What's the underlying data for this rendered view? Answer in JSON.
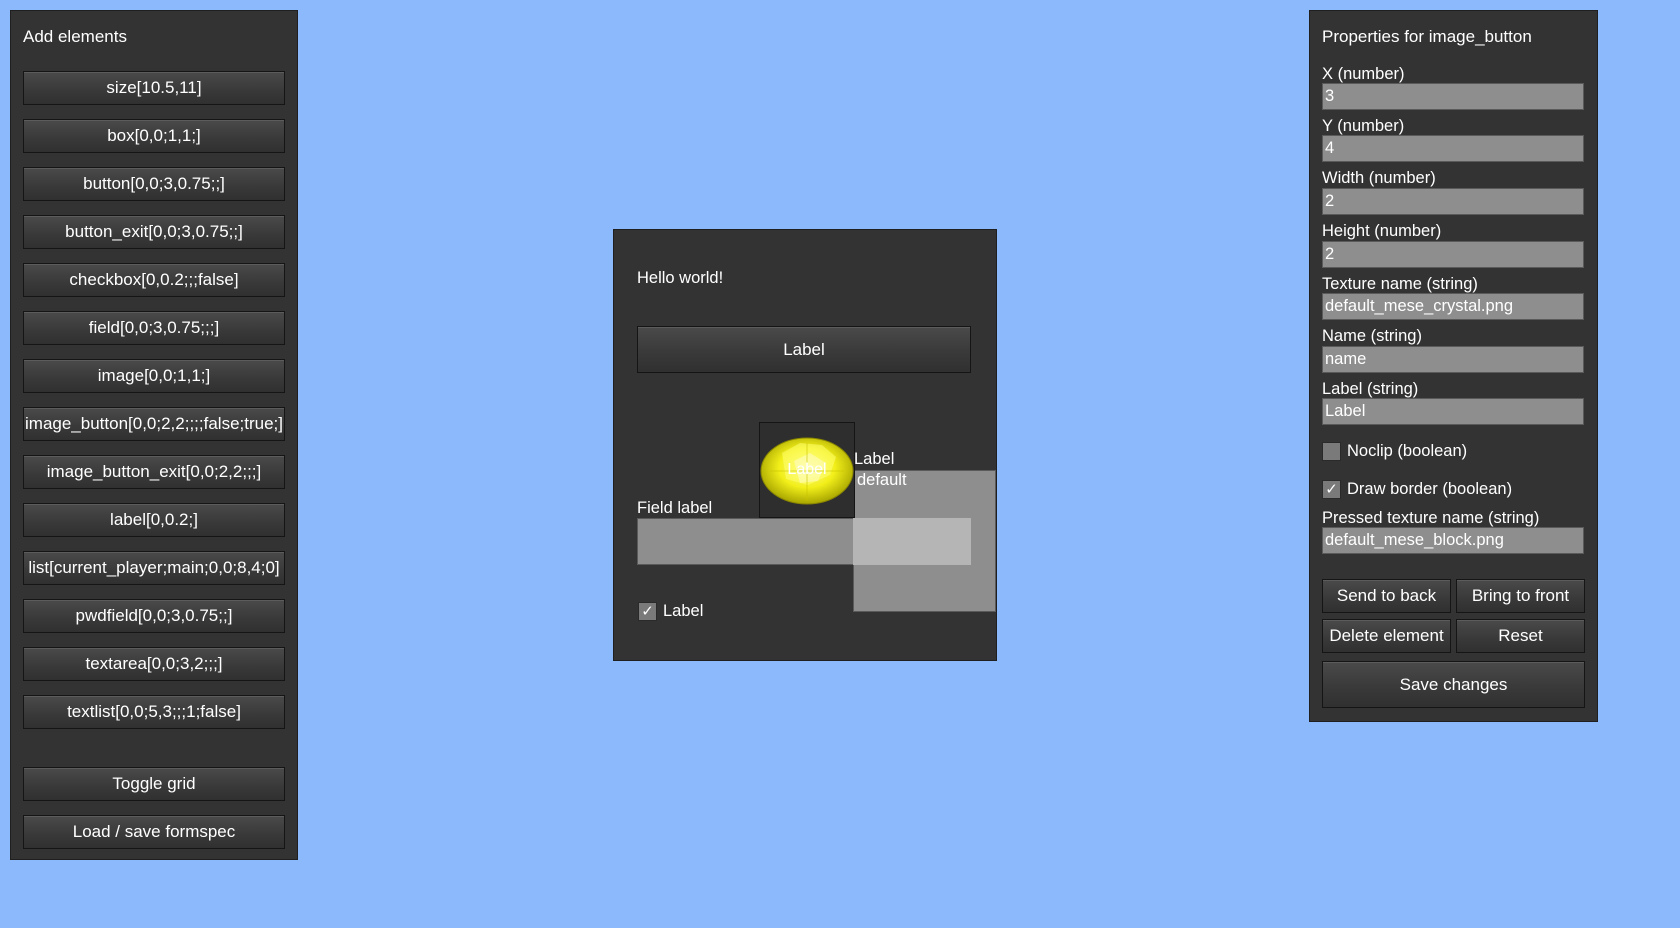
{
  "left_panel": {
    "title": "Add elements",
    "elements": [
      "size[10.5,11]",
      "box[0,0;1,1;]",
      "button[0,0;3,0.75;;]",
      "button_exit[0,0;3,0.75;;]",
      "checkbox[0,0.2;;;false]",
      "field[0,0;3,0.75;;;]",
      "image[0,0;1,1;]",
      "image_button[0,0;2,2;;;;false;true;]",
      "image_button_exit[0,0;2,2;;;]",
      "label[0,0.2;]",
      "list[current_player;main;0,0;8,4;0]",
      "pwdfield[0,0;3,0.75;;]",
      "textarea[0,0;3,2;;;]",
      "textlist[0,0;5,3;;;1;false]"
    ],
    "toggle_grid": "Toggle grid",
    "load_save": "Load / save formspec"
  },
  "preview": {
    "hello": "Hello world!",
    "button_label": "Label",
    "image_button_label": "Label",
    "image_name": "mese-crystal",
    "textlist_label": "Label",
    "textlist_item": "default",
    "field_label": "Field label",
    "field_value": "",
    "checkbox_label": "Label",
    "checkbox_checked": true
  },
  "right_panel": {
    "title": "Properties for image_button",
    "x_label": "X (number)",
    "x_value": "3",
    "y_label": "Y (number)",
    "y_value": "4",
    "w_label": "Width (number)",
    "w_value": "2",
    "h_label": "Height (number)",
    "h_value": "2",
    "texture_label": "Texture name (string)",
    "texture_value": "default_mese_crystal.png",
    "name_label": "Name (string)",
    "name_value": "name",
    "label_label": "Label (string)",
    "label_value": "Label",
    "noclip_label": "Noclip (boolean)",
    "noclip_checked": false,
    "draw_border_label": "Draw border (boolean)",
    "draw_border_checked": true,
    "pressed_label": "Pressed texture name (string)",
    "pressed_value": "default_mese_block.png",
    "send_back": "Send to back",
    "bring_front": "Bring to front",
    "delete": "Delete element",
    "reset": "Reset",
    "save": "Save changes"
  },
  "colors": {
    "background": "#8cb9fc",
    "panel": "#333333",
    "field": "#8e8e8e",
    "mese": "#f2ef1a"
  }
}
